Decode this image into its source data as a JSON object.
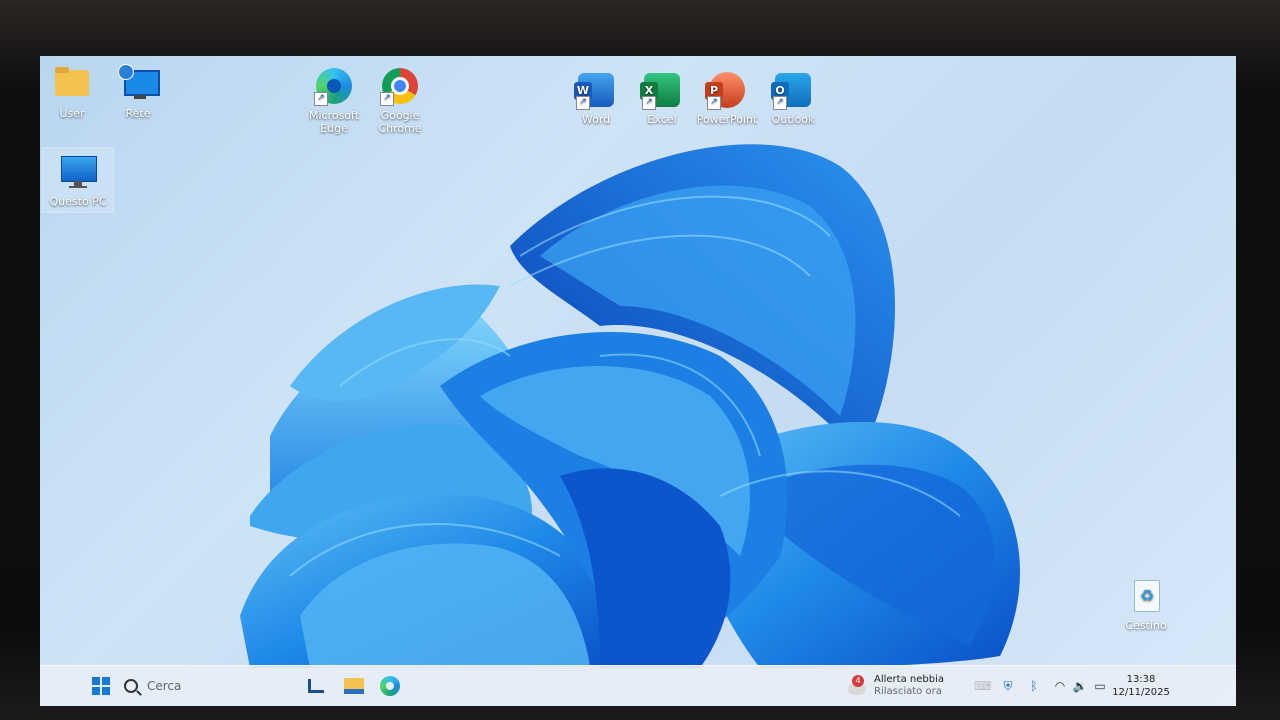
{
  "desktop": {
    "icons": [
      {
        "label": "User",
        "icon": "folder-icon"
      },
      {
        "label": "Rete",
        "icon": "network-icon"
      },
      {
        "label": "Microsoft Edge",
        "icon": "edge-icon"
      },
      {
        "label": "Google Chrome",
        "icon": "chrome-icon"
      },
      {
        "label": "Word",
        "icon": "word-icon"
      },
      {
        "label": "Excel",
        "icon": "excel-icon"
      },
      {
        "label": "PowerPoint",
        "icon": "powerpoint-icon"
      },
      {
        "label": "Outlook",
        "icon": "outlook-icon"
      },
      {
        "label": "Questo PC",
        "icon": "this-pc-icon"
      },
      {
        "label": "Cestino",
        "icon": "recycle-bin-icon"
      }
    ],
    "office_letters": {
      "word": "W",
      "excel": "X",
      "powerpoint": "P",
      "outlook": "O"
    }
  },
  "taskbar": {
    "search_placeholder": "Cerca",
    "weather": {
      "badge": "4",
      "title": "Allerta nebbia",
      "subtitle": "Rilasciato ora"
    },
    "clock": {
      "time": "13:38",
      "date": "12/11/2025"
    }
  },
  "colors": {
    "accent": "#0f6cd6",
    "word": "#185abd",
    "excel": "#107c41",
    "powerpoint": "#c43e1c",
    "outlook": "#0f6cbd"
  }
}
